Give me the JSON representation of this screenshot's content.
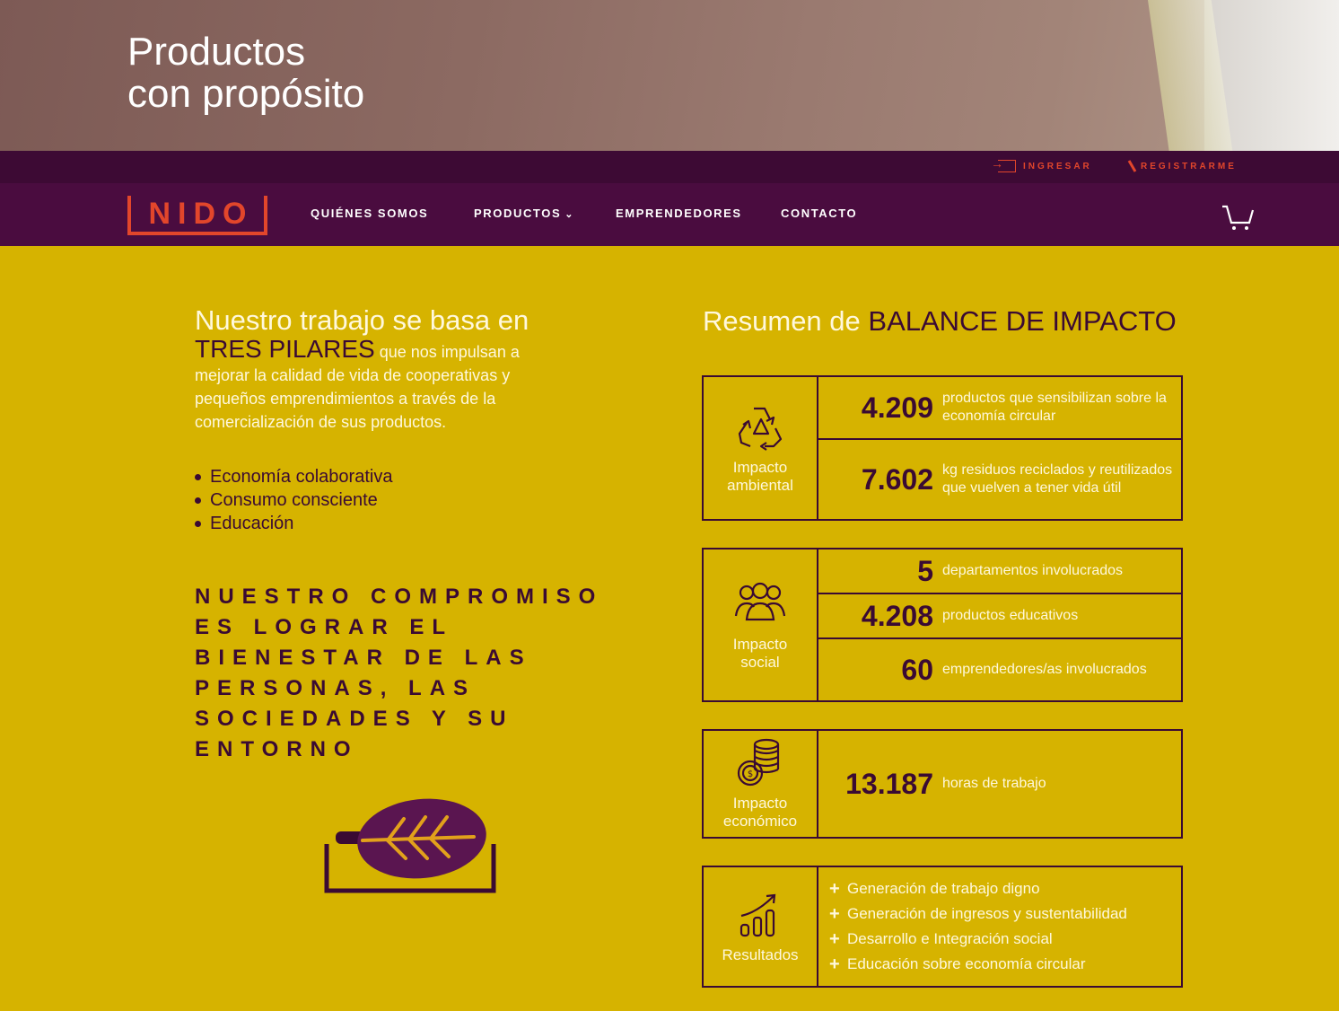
{
  "hero": {
    "title_line1": "Productos",
    "title_line2": "con propósito"
  },
  "topbar": {
    "login": "INGRESAR",
    "register": "REGISTRARME"
  },
  "nav": {
    "logo": "NIDO",
    "items": [
      "QUIÉNES SOMOS",
      "PRODUCTOS",
      "EMPRENDEDORES",
      "CONTACTO"
    ]
  },
  "intro": {
    "line1": "Nuestro trabajo se basa en",
    "strong": "TRES PILARES",
    "body": " que nos impulsan a mejorar la calidad de vida de cooperativas y pequeños emprendimientos a través de la comercialización de sus productos."
  },
  "pillars": [
    "Economía colaborativa",
    "Consumo consciente",
    "Educación"
  ],
  "commitment": "NUESTRO COMPROMISO ES LOGRAR EL BIENESTAR DE LAS PERSONAS, LAS SOCIEDADES Y SU ENTORNO",
  "summary": {
    "prefix": "Resumen de ",
    "strong": "BALANCE DE IMPACTO"
  },
  "impacts": {
    "environmental": {
      "label_line1": "Impacto",
      "label_line2": "ambiental",
      "rows": [
        {
          "value": "4.209",
          "desc": "productos que sensibilizan sobre la economía circular"
        },
        {
          "value": "7.602",
          "desc": "kg residuos reciclados y reutilizados que vuelven a tener vida útil"
        }
      ]
    },
    "social": {
      "label_line1": "Impacto",
      "label_line2": "social",
      "rows": [
        {
          "value": "5",
          "desc": "departamentos involucrados"
        },
        {
          "value": "4.208",
          "desc": "productos educativos"
        },
        {
          "value": "60",
          "desc": "emprendedores/as involucrados"
        }
      ]
    },
    "economic": {
      "label_line1": "Impacto",
      "label_line2": "económico",
      "rows": [
        {
          "value": "13.187",
          "desc": "horas de trabajo"
        }
      ]
    },
    "results": {
      "label": "Resultados",
      "items": [
        "Generación de trabajo digno",
        "Generación de ingresos y sustentabilidad",
        "Desarrollo e Integración social",
        "Educación sobre economía circular"
      ]
    }
  },
  "colors": {
    "background": "#d6b300",
    "nav": "#4a0c3f",
    "accent": "#e2462b",
    "dark": "#3a0a33",
    "light_text": "#fff8dc"
  },
  "icons": [
    "recycle-icon",
    "people-icon",
    "coins-icon",
    "growth-chart-icon",
    "cart-icon",
    "login-icon",
    "pencil-icon",
    "leaf-icon"
  ]
}
